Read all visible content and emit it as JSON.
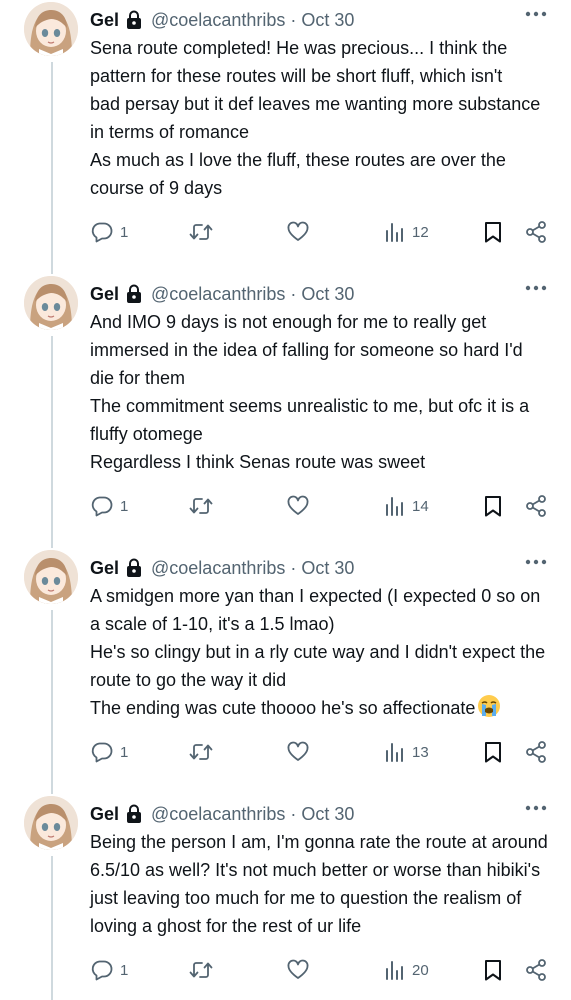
{
  "user": {
    "name": "Gel",
    "handle": "@coelacanthribs",
    "separator": "·"
  },
  "tweets": [
    {
      "date": "Oct 30",
      "lines": [
        "Sena route completed! He was precious... I think the",
        "pattern for these routes will be short fluff, which isn't",
        "bad persay but it def leaves me wanting more substance",
        "in terms of romance",
        "As much as I love the fluff, these routes are over the",
        "course of 9 days"
      ],
      "replies": "1",
      "views": "12"
    },
    {
      "date": "Oct 30",
      "lines": [
        "And IMO 9 days is not enough for me to really get",
        "immersed in the idea of falling for someone so hard I'd",
        "die for them",
        "The commitment seems unrealistic to me, but ofc it is a",
        "fluffy otomege",
        "Regardless I think Senas route was sweet"
      ],
      "replies": "1",
      "views": "14"
    },
    {
      "date": "Oct 30",
      "lines": [
        "A smidgen more yan than I expected (I expected 0 so on",
        "a scale of 1-10, it's a 1.5 lmao)",
        "He's so clingy but in a rly cute way and I didn't expect the",
        "route to go the way it did",
        "The ending was cute thoooo he's so affectionate"
      ],
      "replies": "1",
      "views": "13"
    },
    {
      "date": "Oct 30",
      "lines": [
        "Being the person I am, I'm gonna rate the route at around",
        "6.5/10 as well? It's not much better or worse than hibiki's",
        "just leaving too much for me to question the realism of",
        "loving a ghost for the rest of ur life"
      ],
      "replies": "1",
      "views": "20"
    }
  ],
  "icons": {
    "reply": "speech-bubble-icon",
    "retweet": "retweet-icon",
    "like": "heart-icon",
    "views": "bar-chart-icon",
    "bookmark": "bookmark-icon",
    "share": "share-icon",
    "more": "more-dots-icon",
    "lock": "lock-icon",
    "emoji": "loudly-crying-face-emoji"
  },
  "colors": {
    "text": "#0f1419",
    "secondary": "#536471",
    "thread_line": "#cfd9de"
  }
}
